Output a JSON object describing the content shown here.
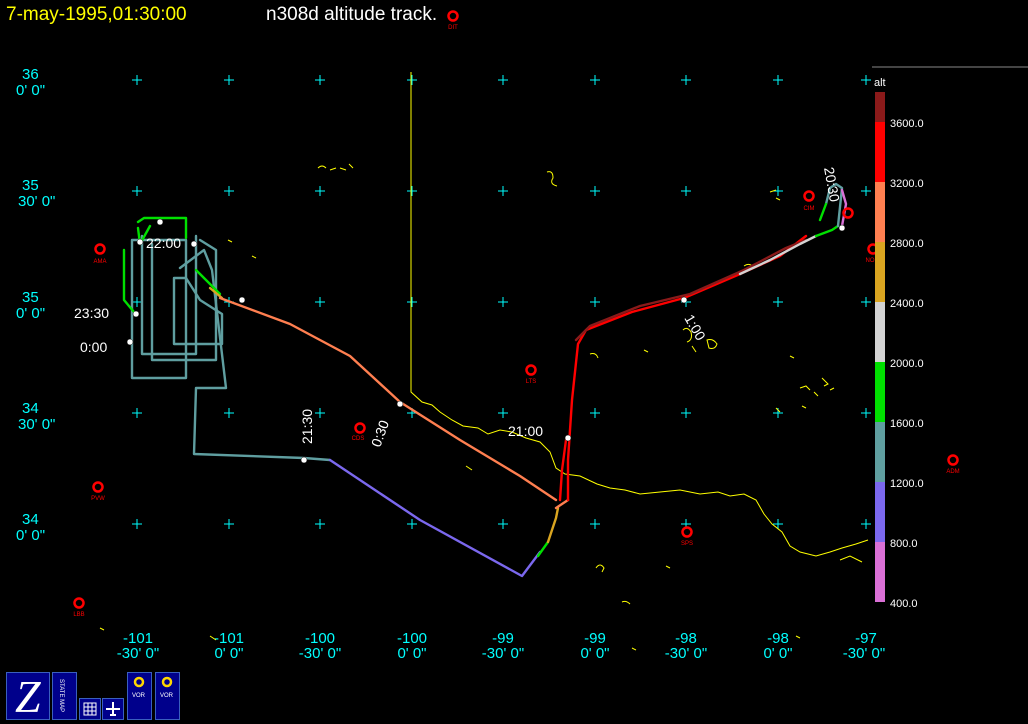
{
  "header": {
    "timestamp": "7-may-1995,01:30:00",
    "title": "n308d altitude track."
  },
  "lat_labels": [
    {
      "deg": "36",
      "min": "0' 0\""
    },
    {
      "deg": "35",
      "min": "30' 0\""
    },
    {
      "deg": "35",
      "min": "0' 0\""
    },
    {
      "deg": "34",
      "min": "30' 0\""
    },
    {
      "deg": "34",
      "min": "0' 0\""
    }
  ],
  "lon_labels": [
    {
      "deg": "-101",
      "min": "-30' 0\""
    },
    {
      "deg": "-101",
      "min": "0' 0\""
    },
    {
      "deg": "-100",
      "min": "-30' 0\""
    },
    {
      "deg": "-100",
      "min": "0' 0\""
    },
    {
      "deg": "-99",
      "min": "-30' 0\""
    },
    {
      "deg": "-99",
      "min": "0' 0\""
    },
    {
      "deg": "-98",
      "min": "-30' 0\""
    },
    {
      "deg": "-98",
      "min": "0' 0\""
    },
    {
      "deg": "-97",
      "min": "-30' 0\""
    }
  ],
  "stations": [
    "AMA",
    "CDS",
    "LTS",
    "PVW",
    "LBB",
    "SPS",
    "CIM",
    "ADM",
    "NO",
    "DIT"
  ],
  "time_labels": [
    "23:30",
    "0:00",
    "22:00",
    "21:30",
    "0:30",
    "21:00",
    "1:00",
    "20:30"
  ],
  "legend": {
    "title": "alt",
    "ticks": [
      "3600.0",
      "3200.0",
      "2800.0",
      "2400.0",
      "2000.0",
      "1600.0",
      "1200.0",
      "800.0",
      "400.0"
    ],
    "colors": [
      "#8b1a1a",
      "#ff0000",
      "#ff7f50",
      "#daa520",
      "#d3d3d3",
      "#00e000",
      "#5f9ea0",
      "#7b68ee",
      "#da70d6"
    ]
  },
  "toolbar": {
    "z_label": "Z",
    "state_map_label": "STATE MAP",
    "vor1_label": "VOR",
    "vor2_label": "VOR"
  },
  "colors": {
    "grid": "#00ffff",
    "boundary": "#ffff00",
    "station": "#ff0000"
  }
}
